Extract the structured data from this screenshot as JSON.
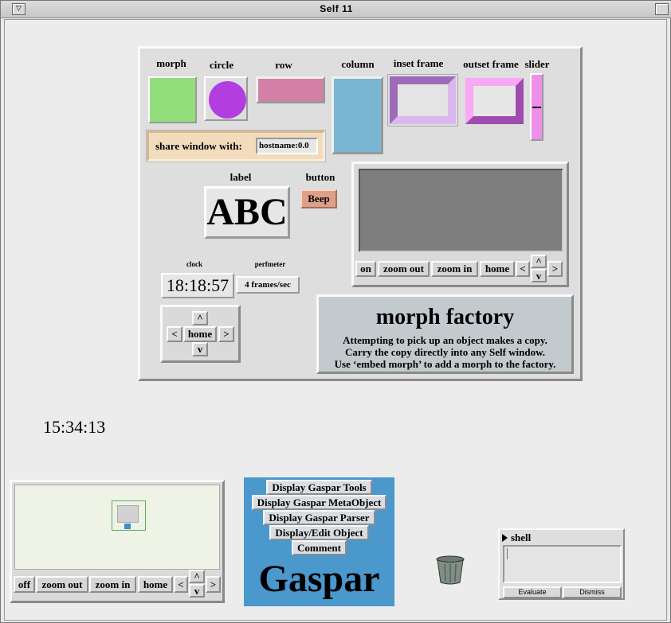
{
  "window": {
    "title": "Self 11"
  },
  "factory": {
    "labels": {
      "morph": "morph",
      "circle": "circle",
      "row": "row",
      "column": "column",
      "inset_frame": "inset frame",
      "outset_frame": "outset frame",
      "slider": "slider",
      "label": "label",
      "button": "button",
      "clock": "clock",
      "perfmeter": "perfmeter"
    },
    "share_label": "share window with:",
    "share_value": "hostname:0.0",
    "abc_text": "ABC",
    "beep_label": "Beep",
    "clock_value": "18:18:57",
    "perf_value": "4 frames/sec",
    "radar_buttons": {
      "on": "on",
      "zoom_out": "zoom out",
      "zoom_in": "zoom in",
      "home": "home",
      "left": "<",
      "up": "^",
      "down": "v",
      "right": ">"
    },
    "nav": {
      "up": "^",
      "down": "v",
      "left": "<",
      "right": ">",
      "home": "home"
    },
    "info": {
      "title": "morph factory",
      "lines": [
        "Attempting to pick up an object makes a copy.",
        "Carry the copy directly into any Self window.",
        "Use ‘embed morph’ to add a morph to the factory."
      ]
    },
    "colors": {
      "morph": "#92de7c",
      "circle": "#b33ee0",
      "row": "#d480a8",
      "column": "#78b6d2",
      "inset_frame": "#9c6cb8",
      "outset_frame": "#f8a8f4",
      "slider": "#ee90ea",
      "share": "#f2dcbc",
      "beep": "#e0a088",
      "info": "#c3cace"
    }
  },
  "desktop_clock": "15:34:13",
  "radar2": {
    "off": "off",
    "zoom_out": "zoom out",
    "zoom_in": "zoom in",
    "home": "home",
    "left": "<",
    "up": "^",
    "down": "v",
    "right": ">"
  },
  "gaspar": {
    "title": "Gaspar",
    "buttons": [
      "Display Gaspar Tools",
      "Display Gaspar MetaObject",
      "Display Gaspar Parser",
      "Display/Edit Object",
      "Comment"
    ],
    "color": "#4a98cc"
  },
  "shell": {
    "title": "shell",
    "evaluate": "Evaluate",
    "dismiss": "Dismiss"
  },
  "icons": {
    "trash": "trash-can-icon",
    "title_close": "window-menu-icon",
    "title_zoom": "window-zoom-icon"
  }
}
